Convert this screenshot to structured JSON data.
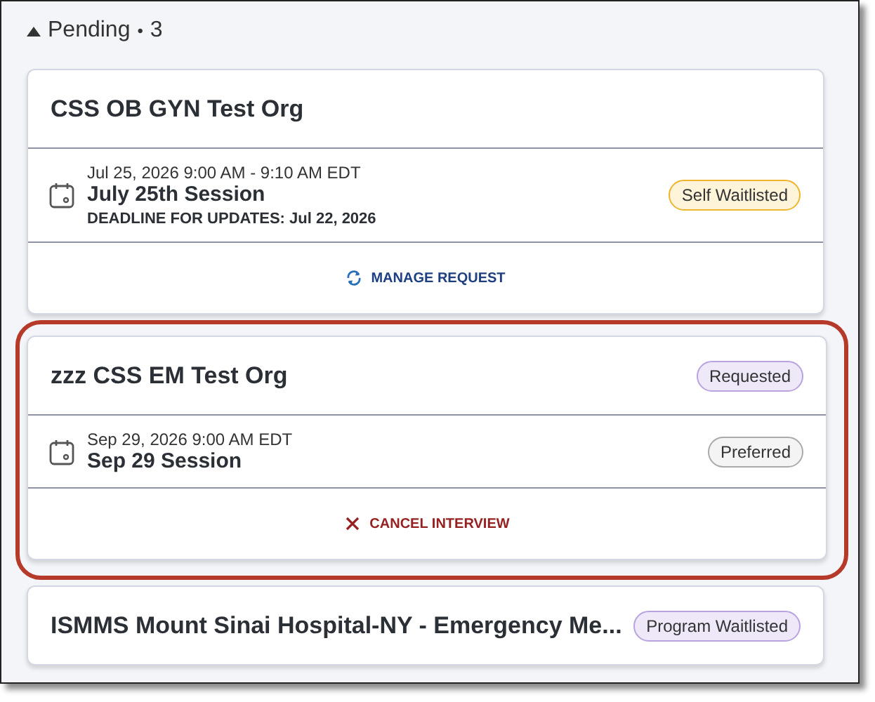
{
  "section": {
    "label": "Pending",
    "separator": "•",
    "count": "3",
    "expanded": true
  },
  "cards": [
    {
      "title": "CSS OB GYN Test Org",
      "highlighted": false,
      "session": {
        "datetime": "Jul 25, 2026 9:00 AM - 9:10 AM EDT",
        "name": "July 25th Session",
        "deadline": "DEADLINE FOR UPDATES: Jul 22, 2026",
        "badge": {
          "label": "Self Waitlisted",
          "kind": "warning"
        }
      },
      "action": {
        "label": "MANAGE REQUEST",
        "kind": "manage"
      }
    },
    {
      "title": "zzz CSS EM Test Org",
      "highlighted": true,
      "badge": {
        "label": "Requested",
        "kind": "info"
      },
      "session": {
        "datetime": "Sep 29, 2026 9:00 AM EDT",
        "name": "Sep 29 Session",
        "badge": {
          "label": "Preferred",
          "kind": "neutral"
        }
      },
      "action": {
        "label": "CANCEL INTERVIEW",
        "kind": "cancel"
      }
    },
    {
      "title": "ISMMS Mount Sinai Hospital-NY - Emergency Me...",
      "highlighted": false,
      "badge": {
        "label": "Program Waitlisted",
        "kind": "info"
      }
    }
  ]
}
